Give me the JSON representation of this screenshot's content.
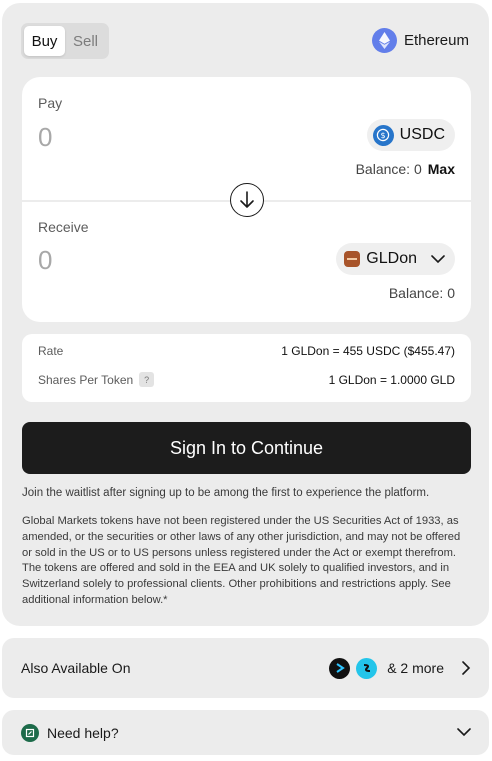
{
  "trade_tabs": {
    "buy": "Buy",
    "sell": "Sell",
    "active": "buy"
  },
  "network": {
    "name": "Ethereum",
    "icon": "ethereum-icon",
    "color": "#627eea"
  },
  "pay": {
    "label": "Pay",
    "amount": "0",
    "token": "USDC",
    "token_icon": "usdc-icon",
    "balance_text": "Balance: 0",
    "max_label": "Max"
  },
  "receive": {
    "label": "Receive",
    "amount": "0",
    "token": "GLDon",
    "token_icon": "gldon-icon",
    "balance_text": "Balance: 0"
  },
  "swap_icon": "arrow-down-icon",
  "info": {
    "rate_label": "Rate",
    "rate_value": "1 GLDon = 455 USDC ($455.47)",
    "shares_label": "Shares Per Token",
    "shares_help": "?",
    "shares_value": "1 GLDon = 1.0000 GLD"
  },
  "cta_label": "Sign In to Continue",
  "waitlist_note": "Join the waitlist after signing up to be among the first to experience the platform.",
  "disclaimer": "Global Markets tokens have not been registered under the US Securities Act of 1933, as amended, or the securities or other laws of any other jurisdiction, and may not be offered or sold in the US or to US persons unless registered under the Act or exempt therefrom. The tokens are offered and sold in the EEA and UK solely to qualified investors, and in Switzerland solely to professional clients. Other prohibitions and restrictions apply. See additional information below.*",
  "also_available": {
    "label": "Also Available On",
    "more_text": "& 2 more"
  },
  "help": {
    "label": "Need help?"
  },
  "colors": {
    "accent_dark": "#1c1c1c",
    "panel_bg": "#ececec",
    "gldon_badge": "#a8542a",
    "usdc": "#2775ca"
  }
}
